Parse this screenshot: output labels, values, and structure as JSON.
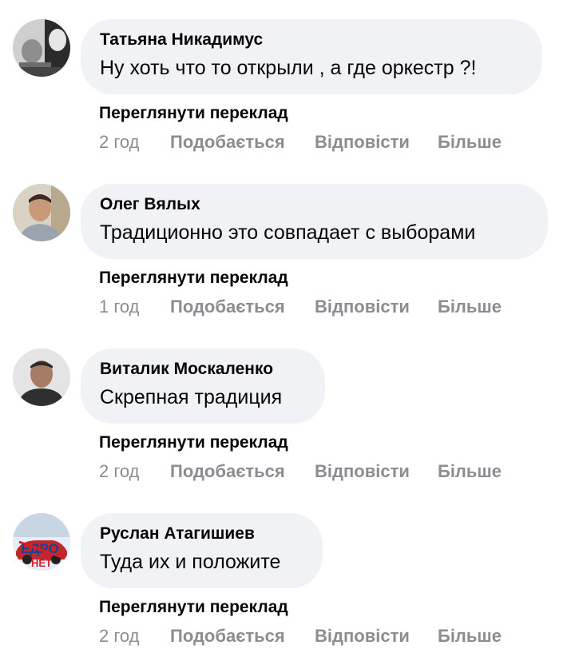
{
  "actions": {
    "translate_label": "Переглянути переклад",
    "like_label": "Подобається",
    "reply_label": "Відповісти",
    "more_label": "Більше"
  },
  "colors": {
    "bubble_bg": "#f0f2f5",
    "meta_text": "#8a8d91",
    "primary_text": "#050505"
  },
  "comments": [
    {
      "author": "Татьяна Никадимус",
      "text": "Ну хоть что то открыли , а где оркестр ?!",
      "time": "2 год",
      "avatar_icon": "user-photo-avatar"
    },
    {
      "author": "Олег Вялых",
      "text": "Традиционно это совпадает с выборами",
      "time": "1 год",
      "avatar_icon": "user-photo-avatar"
    },
    {
      "author": "Виталик Москаленко",
      "text": "Скрепная традиция",
      "time": "2 год",
      "avatar_icon": "user-photo-avatar"
    },
    {
      "author": "Руслан Атагишиев",
      "text": "Туда их и положите",
      "time": "2 год",
      "avatar_icon": "user-photo-avatar",
      "avatar_text": "ЕДРО НЕТ"
    }
  ]
}
